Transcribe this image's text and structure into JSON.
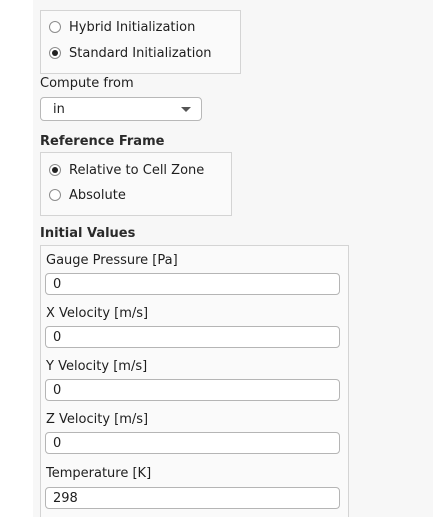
{
  "initialization": {
    "methods": [
      {
        "label": "Hybrid  Initialization",
        "checked": false
      },
      {
        "label": "Standard Initialization",
        "checked": true
      }
    ]
  },
  "compute_from": {
    "label": "Compute from",
    "selected": "in"
  },
  "reference_frame": {
    "title": "Reference Frame",
    "options": [
      {
        "label": "Relative to Cell Zone",
        "checked": true
      },
      {
        "label": "Absolute",
        "checked": false
      }
    ]
  },
  "initial_values": {
    "title": "Initial Values",
    "fields": [
      {
        "label": "Gauge Pressure [Pa]",
        "value": "0"
      },
      {
        "label": "X Velocity [m/s]",
        "value": "0"
      },
      {
        "label": "Y Velocity [m/s]",
        "value": "0"
      },
      {
        "label": "Z Velocity [m/s]",
        "value": "0"
      },
      {
        "label": "Temperature [K]",
        "value": "298"
      }
    ]
  }
}
